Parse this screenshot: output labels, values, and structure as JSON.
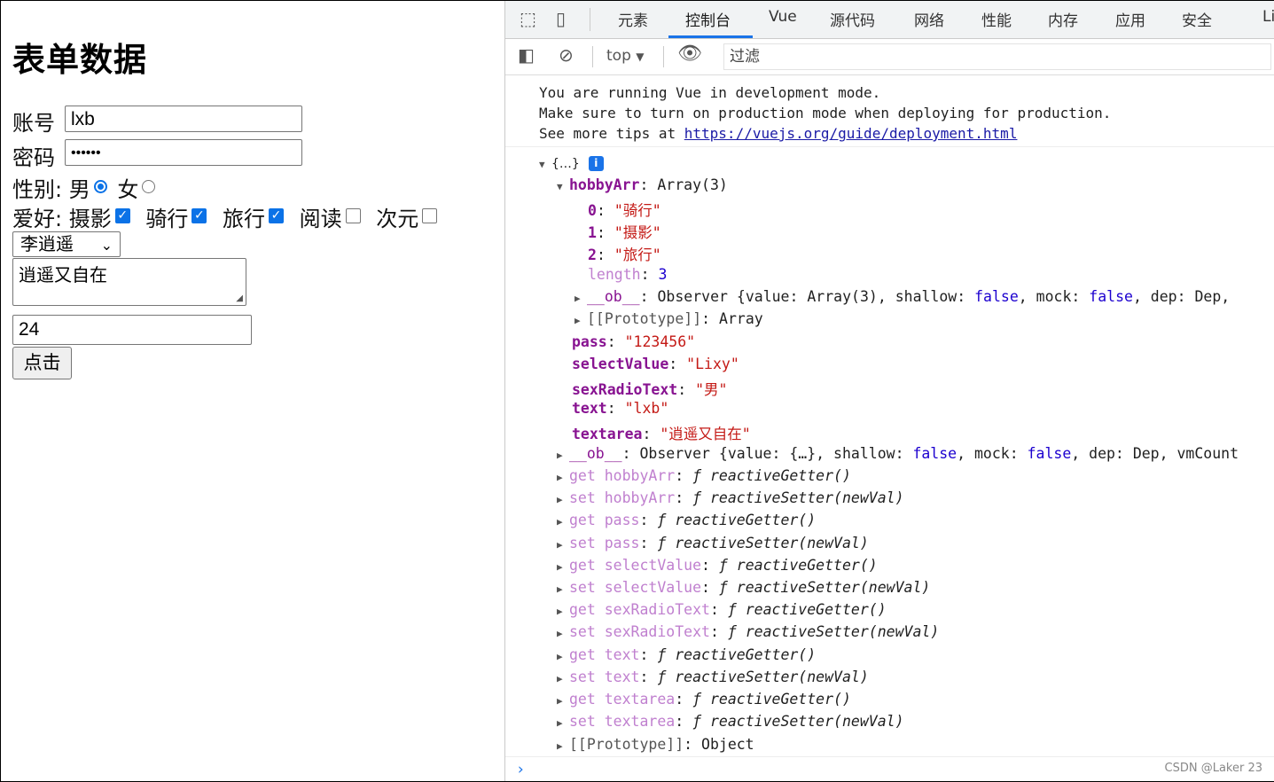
{
  "form": {
    "title": "表单数据",
    "account_label": "账号",
    "account_value": "lxb",
    "password_label": "密码",
    "password_value": "••••••",
    "gender_label": "性别:",
    "gender_options": [
      "男",
      "女"
    ],
    "gender_selected": "男",
    "hobby_label": "爱好:",
    "hobbies": [
      {
        "label": "摄影",
        "checked": true
      },
      {
        "label": "骑行",
        "checked": true
      },
      {
        "label": "旅行",
        "checked": true
      },
      {
        "label": "阅读",
        "checked": false
      },
      {
        "label": "次元",
        "checked": false
      }
    ],
    "select_value": "李逍遥",
    "textarea_value": "逍遥又自在",
    "number_value": "24",
    "button_label": "点击"
  },
  "devtools": {
    "tabs": [
      "元素",
      "控制台",
      "Vue",
      "源代码",
      "网络",
      "性能",
      "内存",
      "应用",
      "安全",
      "Li"
    ],
    "active_tab": "控制台",
    "context": "top",
    "filter_placeholder": "过滤",
    "messages": [
      "You are running Vue in development mode.",
      "Make sure to turn on production mode when deploying for production.",
      "See more tips at "
    ],
    "message_link": "https://vuejs.org/guide/deployment.html",
    "object_summary": "{…}",
    "tree": {
      "hobbyArr_key": "hobbyArr",
      "hobbyArr_val": "Array(3)",
      "items": [
        {
          "k": "0",
          "v": "\"骑行\""
        },
        {
          "k": "1",
          "v": "\"摄影\""
        },
        {
          "k": "2",
          "v": "\"旅行\""
        }
      ],
      "length_key": "length",
      "length_val": "3",
      "arr_ob_key": "__ob__",
      "arr_ob_pre": "Observer {value: Array(3), shallow: ",
      "arr_proto_key": "[[Prototype]]",
      "arr_proto_val": "Array",
      "pass_key": "pass",
      "pass_val": "\"123456\"",
      "select_key": "selectValue",
      "select_val": "\"Lixy\"",
      "sex_key": "sexRadioText",
      "sex_val": "\"男\"",
      "text_key": "text",
      "text_val": "\"lxb\"",
      "textarea_key": "textarea",
      "textarea_val": "\"逍遥又自在\"",
      "ob_key": "__ob__",
      "ob_pre": "Observer {value: {…}, shallow: ",
      "false_word": "false",
      "mock_word": ", mock: ",
      "dep_word": ", dep: ",
      "dep_val": "Dep",
      "vmcount_word": ", vmCount",
      "arr_tail": ", ",
      "accessors": [
        {
          "k": "get hobbyArr",
          "v": "reactiveGetter()"
        },
        {
          "k": "set hobbyArr",
          "v": "reactiveSetter(newVal)"
        },
        {
          "k": "get pass",
          "v": "reactiveGetter()"
        },
        {
          "k": "set pass",
          "v": "reactiveSetter(newVal)"
        },
        {
          "k": "get selectValue",
          "v": "reactiveGetter()"
        },
        {
          "k": "set selectValue",
          "v": "reactiveSetter(newVal)"
        },
        {
          "k": "get sexRadioText",
          "v": "reactiveGetter()"
        },
        {
          "k": "set sexRadioText",
          "v": "reactiveSetter(newVal)"
        },
        {
          "k": "get text",
          "v": "reactiveGetter()"
        },
        {
          "k": "set text",
          "v": "reactiveSetter(newVal)"
        },
        {
          "k": "get textarea",
          "v": "reactiveGetter()"
        },
        {
          "k": "set textarea",
          "v": "reactiveSetter(newVal)"
        }
      ],
      "obj_proto_key": "[[Prototype]]",
      "obj_proto_val": "Object",
      "f_symbol": "ƒ"
    },
    "prompt": "›"
  },
  "watermark": "CSDN @Laker 23",
  "colors": {
    "accent": "#1a73e8",
    "checkbox": "#0b72e7",
    "key": "#881391",
    "string": "#c41a16",
    "number": "#1c00cf"
  }
}
